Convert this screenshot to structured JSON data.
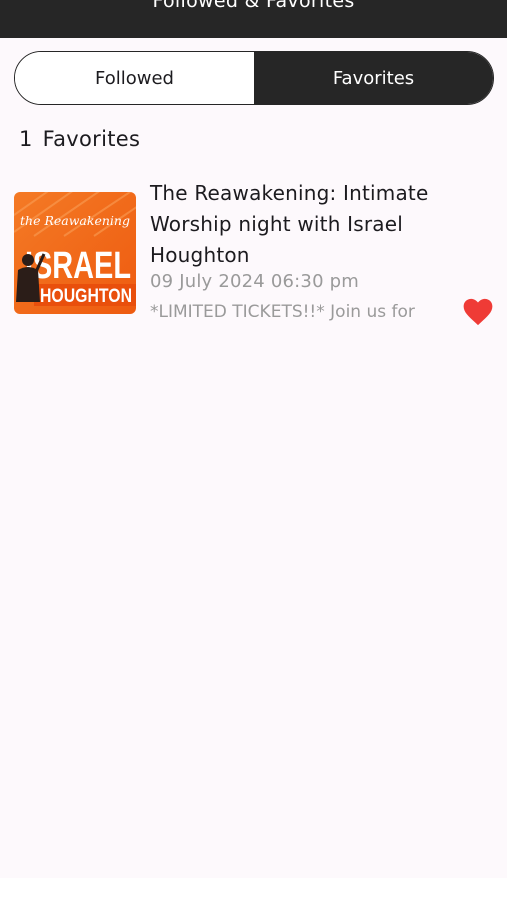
{
  "header": {
    "title": "Followed & Favorites"
  },
  "tabs": {
    "followed": "Followed",
    "favorites": "Favorites",
    "active": "favorites"
  },
  "summary": {
    "count": "1",
    "label": "Favorites"
  },
  "favorites": [
    {
      "title": "The Reawakening: Intimate Worship night with Israel Houghton",
      "date": "09 July 2024 06:30 pm",
      "description": "*LIMITED TICKETS!!* Join us for",
      "favorited": true,
      "thumbnail": {
        "script": "the Reawakening",
        "name_line1": "ISRAEL",
        "name_line2": "HOUGHTON",
        "accent_color": "#f25c13"
      }
    }
  ],
  "colors": {
    "bar": "#262626",
    "heart": "#ef3b36",
    "muted_text": "#9a9a9a"
  }
}
